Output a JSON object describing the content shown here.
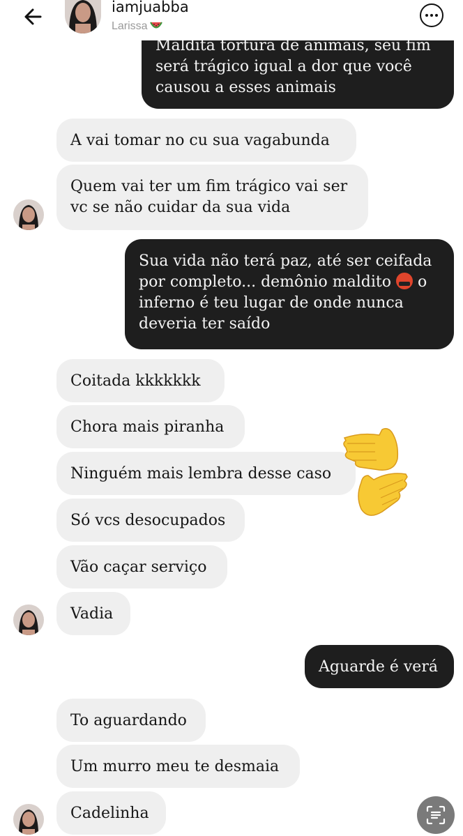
{
  "header": {
    "username": "iamjuabba",
    "display_name": "Larissa",
    "display_name_emoji": "watermelon-icon",
    "back_icon": "arrow-left-icon",
    "more_icon": "more-options-icon"
  },
  "messages": {
    "m1": {
      "sender": "me",
      "lines": [
        "Maldita tortura de animais, seu fim",
        "será trágico igual a dor que você",
        "causou a esses animais"
      ]
    },
    "m2": {
      "sender": "them",
      "text": "A vai tomar no cu sua vagabunda"
    },
    "m3": {
      "sender": "them",
      "lines": [
        "Quem vai ter um fim trágico vai ser",
        "vc se não cuidar da sua vida"
      ]
    },
    "m4": {
      "sender": "me",
      "lines": [
        "Sua vida não terá paz, até ser ceifada",
        "por completo... demônio maldito",
        " o",
        "inferno é teu lugar de onde nunca",
        "deveria ter saído"
      ]
    },
    "m5": {
      "sender": "them",
      "text": "Coitada kkkkkkk"
    },
    "m6": {
      "sender": "them",
      "text": "Chora mais piranha"
    },
    "m7": {
      "sender": "them",
      "text": "Ninguém mais lembra desse caso"
    },
    "m8": {
      "sender": "them",
      "text": "Só vcs desocupados"
    },
    "m9": {
      "sender": "them",
      "text": "Vão caçar serviço"
    },
    "m10": {
      "sender": "them",
      "text": "Vadia"
    },
    "m11": {
      "sender": "me",
      "text": "Aguarde é verá"
    },
    "m12": {
      "sender": "them",
      "text": "To aguardando"
    },
    "m13": {
      "sender": "them",
      "text": "Um murro meu te desmaia"
    },
    "m14": {
      "sender": "them",
      "text": "Cadelinha"
    }
  },
  "emojis": {
    "in_message_4": "face-with-symbols-on-mouth-icon",
    "overlay": "waving-hands-icon"
  },
  "floating_button": {
    "icon": "scan-text-icon"
  },
  "colors": {
    "outgoing_bubble": "#1e1e1e",
    "incoming_bubble": "#efefef",
    "secondary_text": "#9a9a9a"
  }
}
